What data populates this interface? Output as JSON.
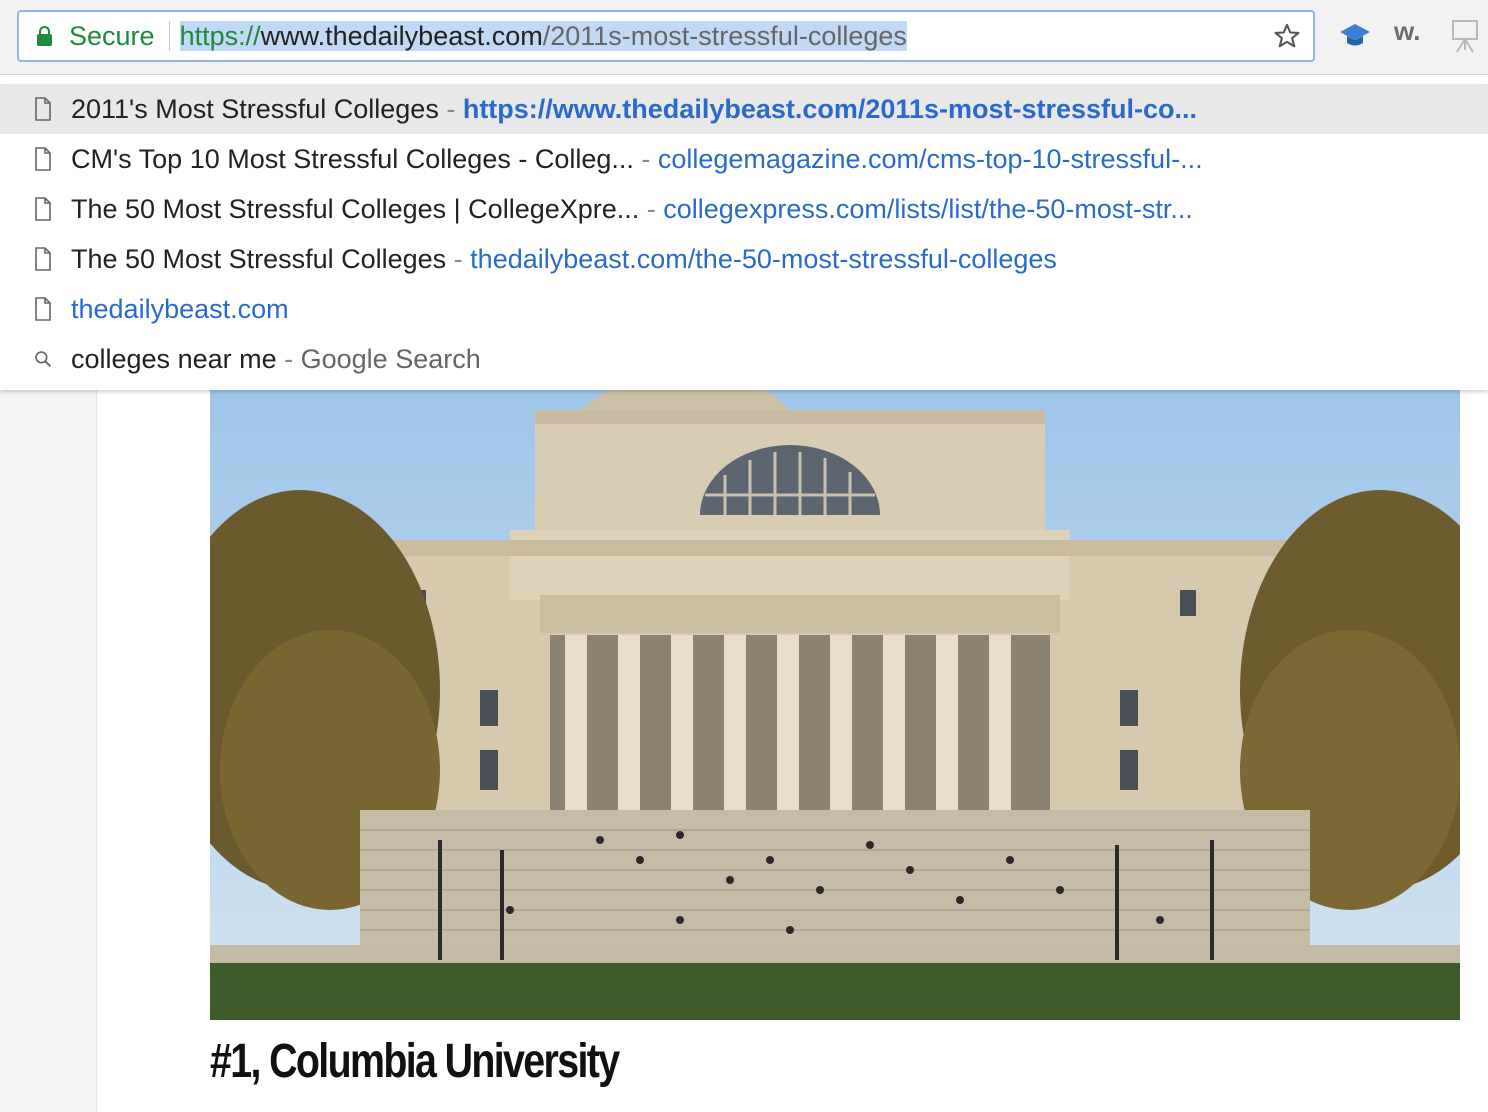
{
  "toolbar": {
    "secure_label": "Secure",
    "url": {
      "scheme": "https://",
      "host": "www.thedailybeast.com",
      "path": "/2011s-most-stressful-colleges"
    },
    "extensions": [
      {
        "name": "graduation-cap-icon"
      },
      {
        "name": "w-extension",
        "label": "w."
      },
      {
        "name": "easel-icon"
      }
    ]
  },
  "suggestions": [
    {
      "icon": "page-icon",
      "title": "2011's Most Stressful Colleges",
      "separator": " - ",
      "url": "https://www.thedailybeast.com/2011s-most-stressful-co...",
      "selected": true
    },
    {
      "icon": "page-icon",
      "title": "CM's Top 10 Most Stressful Colleges - Colleg...",
      "separator": " - ",
      "url": "collegemagazine.com/cms-top-10-stressful-..."
    },
    {
      "icon": "page-icon",
      "title": "The 50 Most Stressful Colleges | CollegeXpre...",
      "separator": " - ",
      "url": "collegexpress.com/lists/list/the-50-most-str..."
    },
    {
      "icon": "page-icon",
      "title": "The 50 Most Stressful Colleges",
      "separator": " - ",
      "url": "thedailybeast.com/the-50-most-stressful-colleges"
    },
    {
      "icon": "page-icon",
      "title": "",
      "separator": "",
      "url": "thedailybeast.com"
    },
    {
      "icon": "search-icon",
      "title": "colleges near me",
      "separator": " - ",
      "url": "Google Search"
    }
  ],
  "page": {
    "heading": "#1, Columbia University"
  },
  "colors": {
    "secure_green": "#1e8a3a",
    "link_blue": "#2a6acc",
    "selection_blue": "#c2d9f6",
    "focus_ring": "#8fb6e6"
  }
}
